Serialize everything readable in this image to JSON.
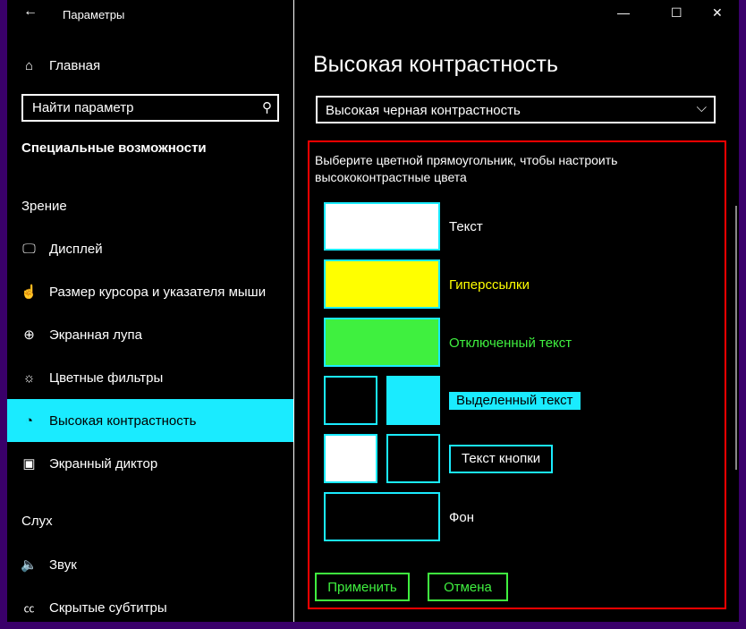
{
  "window": {
    "title": "Параметры",
    "back_icon": "←",
    "minimize": "—",
    "maximize": "☐",
    "close": "✕"
  },
  "sidebar": {
    "home": "Главная",
    "search_placeholder": "Найти параметр",
    "heading": "Специальные возможности",
    "section_vision": "Зрение",
    "items": [
      {
        "label": "Дисплей",
        "icon": "🖵"
      },
      {
        "label": "Размер курсора и указателя мыши",
        "icon": "☝"
      },
      {
        "label": "Экранная лупа",
        "icon": "⊕"
      },
      {
        "label": "Цветные фильтры",
        "icon": "☼"
      },
      {
        "label": "Высокая контрастность",
        "icon": "◔"
      },
      {
        "label": "Экранный диктор",
        "icon": "▣"
      }
    ],
    "section_hearing": "Слух",
    "hearing_items": [
      {
        "label": "Звук",
        "icon": "🔈"
      },
      {
        "label": "Скрытые субтитры",
        "icon": "㏄"
      }
    ]
  },
  "main": {
    "title": "Высокая контрастность",
    "theme_select": "Высокая черная контрастность",
    "instruction": "Выберите цветной прямоугольник, чтобы настроить высококонтрастные цвета",
    "labels": {
      "text": "Текст",
      "hyperlinks": "Гиперссылки",
      "disabled": "Отключенный текст",
      "selected": "Выделенный текст",
      "button": "Текст кнопки",
      "background": "Фон"
    },
    "apply": "Применить",
    "cancel": "Отмена"
  },
  "colors": {
    "text": "#ffffff",
    "hyperlinks": "#ffff00",
    "disabled": "#3ff03f",
    "selected_bg": "#1aebff",
    "button_bg": "#000000",
    "background": "#000000",
    "accent": "#1aebff",
    "highlight": "#ff0000"
  }
}
